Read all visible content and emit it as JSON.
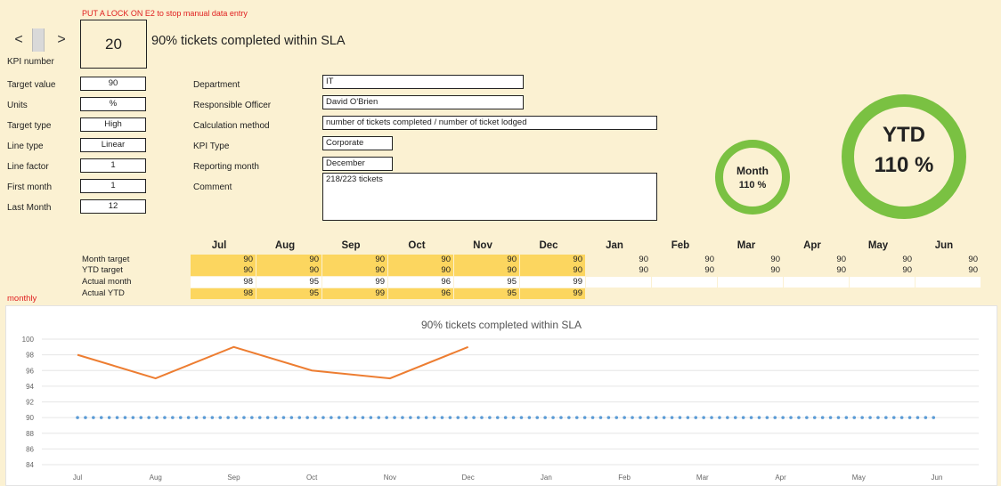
{
  "warning": "PUT A LOCK ON E2 to stop manual data entry",
  "nav": {
    "prev": "<",
    "next": ">"
  },
  "kpi": {
    "number_label": "KPI number",
    "number": "20",
    "title": "90% tickets completed within SLA"
  },
  "left_fields": [
    {
      "label": "Target value",
      "value": "90"
    },
    {
      "label": "Units",
      "value": "%"
    },
    {
      "label": "Target type",
      "value": "High"
    },
    {
      "label": "Line type",
      "value": "Linear"
    },
    {
      "label": "Line factor",
      "value": "1"
    },
    {
      "label": "First month",
      "value": "1"
    },
    {
      "label": "Last Month",
      "value": "12"
    }
  ],
  "mid_fields": {
    "department": {
      "label": "Department",
      "value": "IT"
    },
    "officer": {
      "label": "Responsible Officer",
      "value": "David O'Brien"
    },
    "calc": {
      "label": "Calculation method",
      "value": "number of tickets completed / number of ticket lodged"
    },
    "kpitype": {
      "label": "KPI Type",
      "value": "Corporate"
    },
    "month": {
      "label": "Reporting month",
      "value": "December"
    },
    "comment": {
      "label": "Comment",
      "value": "218/223 tickets"
    }
  },
  "gauges": {
    "month": {
      "label": "Month",
      "value": "110 %"
    },
    "ytd": {
      "label": "YTD",
      "value": "110 %"
    },
    "color": "#7ac142"
  },
  "table": {
    "months": [
      "Jul",
      "Aug",
      "Sep",
      "Oct",
      "Nov",
      "Dec",
      "Jan",
      "Feb",
      "Mar",
      "Apr",
      "May",
      "Jun"
    ],
    "rows": [
      {
        "label": "Month target",
        "values": [
          "90",
          "90",
          "90",
          "90",
          "90",
          "90",
          "90",
          "90",
          "90",
          "90",
          "90",
          "90"
        ]
      },
      {
        "label": "YTD target",
        "values": [
          "90",
          "90",
          "90",
          "90",
          "90",
          "90",
          "90",
          "90",
          "90",
          "90",
          "90",
          "90"
        ]
      },
      {
        "label": "Actual month",
        "values": [
          "98",
          "95",
          "99",
          "96",
          "95",
          "99",
          "",
          "",
          "",
          "",
          "",
          ""
        ]
      },
      {
        "label": "Actual YTD",
        "values": [
          "98",
          "95",
          "99",
          "96",
          "95",
          "99",
          "",
          "",
          "",
          "",
          "",
          ""
        ]
      }
    ],
    "side_label": "monthly"
  },
  "chart_data": {
    "type": "line",
    "title": "90% tickets completed within SLA",
    "categories": [
      "Jul",
      "Aug",
      "Sep",
      "Oct",
      "Nov",
      "Dec",
      "Jan",
      "Feb",
      "Mar",
      "Apr",
      "May",
      "Jun"
    ],
    "series": [
      {
        "values": [
          98,
          95,
          99,
          96,
          95,
          99
        ],
        "color": "#ed7d31",
        "style": "solid"
      },
      {
        "values": [
          90,
          90,
          90,
          90,
          90,
          90,
          90,
          90,
          90,
          90,
          90,
          90
        ],
        "color": "#5b9bd5",
        "style": "dotted"
      }
    ],
    "ylim": [
      84,
      100
    ],
    "yticks": [
      "84",
      "86",
      "88",
      "90",
      "92",
      "94",
      "96",
      "98",
      "100"
    ],
    "grid": true
  }
}
